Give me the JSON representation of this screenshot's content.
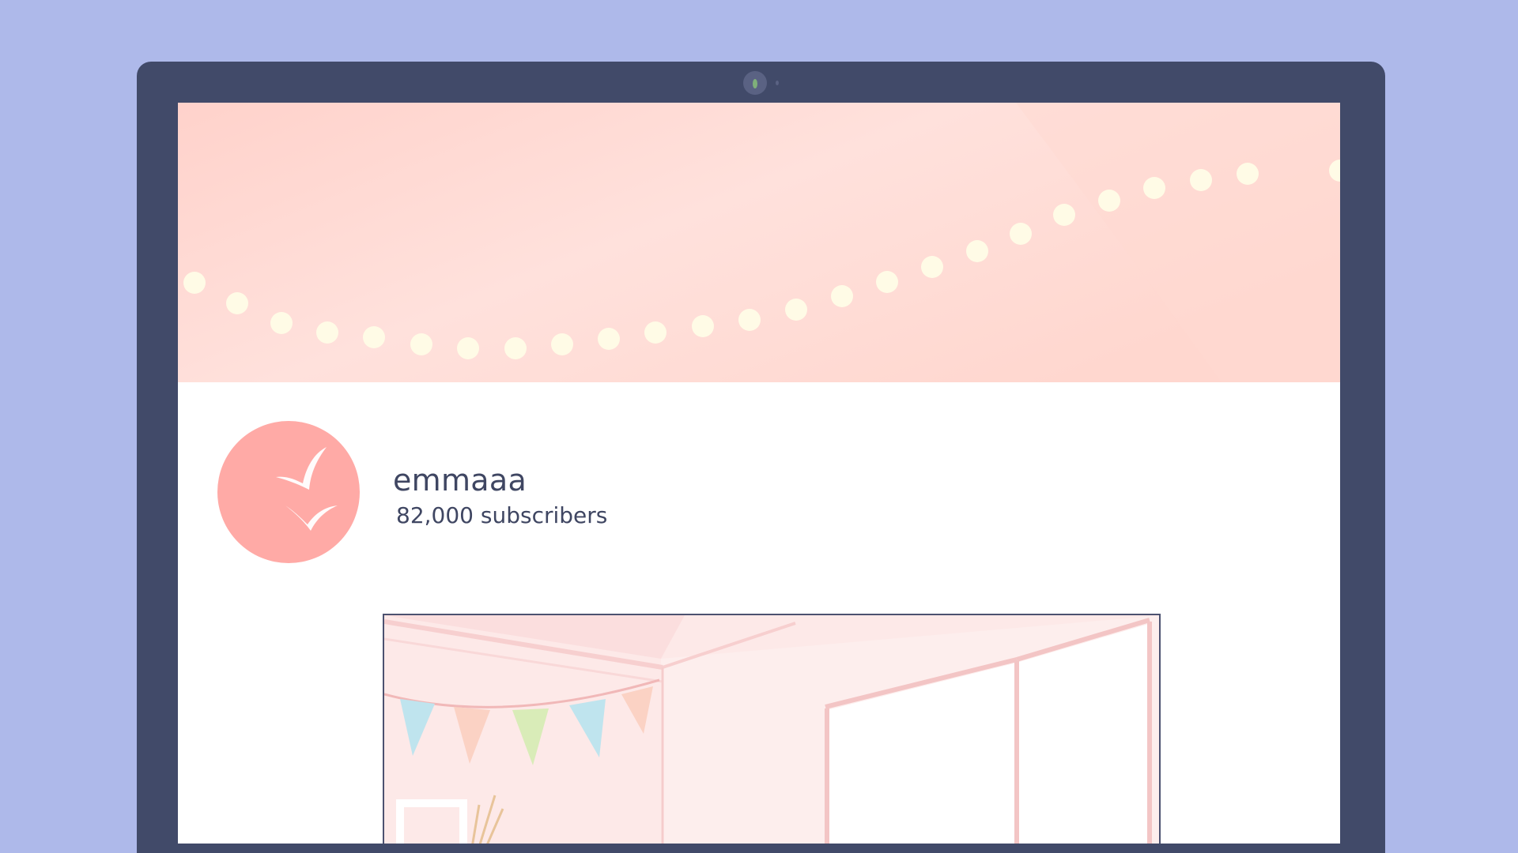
{
  "channel": {
    "name": "emmaaa",
    "subscribers": "82,000 subscribers"
  },
  "icons": {
    "avatar": "birds-icon",
    "camera": "webcam-icon"
  },
  "colors": {
    "background": "#aeb9ea",
    "laptop_frame": "#414a69",
    "banner_pink": "#ffd6cf",
    "avatar_pink": "#ffaaa6",
    "text": "#3f4662"
  }
}
